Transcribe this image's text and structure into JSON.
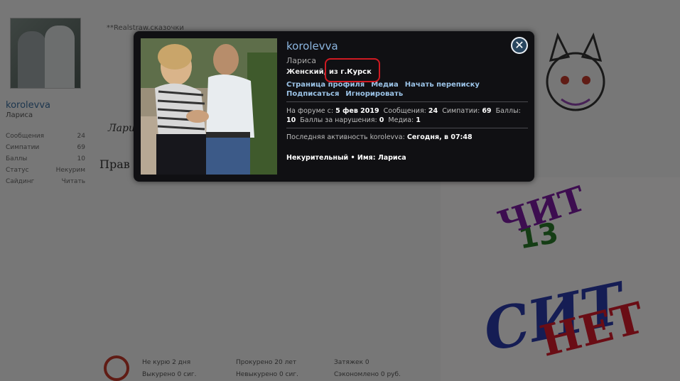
{
  "background": {
    "sidebar": {
      "username": "korolevva",
      "realname": "Лариса",
      "stats": [
        {
          "label": "Сообщения",
          "value": "24"
        },
        {
          "label": "Симпатии",
          "value": "69"
        },
        {
          "label": "Баллы",
          "value": "10"
        },
        {
          "label": "Статус",
          "value": "Некурим"
        },
        {
          "label": "Сайдинг",
          "value": "Читать"
        }
      ]
    },
    "post_top": "**Realstraw.сказочки",
    "signature": "Лари",
    "post_text": "Прав",
    "footer": {
      "col1": [
        "Не курю 2 дня",
        "Выкурено 0 сиг."
      ],
      "col2": [
        "Прокурено 20 лет",
        "Невыкурено 0 сиг."
      ],
      "col3": [
        "Затяжек 0",
        "Сэкономлено 0 руб."
      ]
    },
    "art": {
      "w1": "ЧИТ",
      "w2": "СИТ",
      "w3": "НЕТ",
      "w4": "13"
    }
  },
  "card": {
    "username": "korolevva",
    "realname": "Лариса",
    "gender": "Женский,",
    "from_word": "из",
    "location": "г.Курск",
    "links": {
      "profile": "Страница профиля",
      "media": "Медиа",
      "conversation": "Начать переписку",
      "follow": "Подписаться",
      "ignore": "Игнорировать"
    },
    "stats": {
      "forum_label": "На форуме с:",
      "forum_value": "5 фев 2019",
      "posts_label": "Сообщения:",
      "posts_value": "24",
      "likes_label": "Симпатии:",
      "likes_value": "69",
      "points_label": "Баллы:",
      "points_value": "10",
      "warn_label": "Баллы за нарушения:",
      "warn_value": "0",
      "media_label": "Медиа:",
      "media_value": "1"
    },
    "last_activity_label": "Последняя активность korolevva:",
    "last_activity_value": "Сегодня, в 07:48",
    "extra": "Некурительный • Имя: Лариса",
    "close_icon": "close-icon"
  }
}
